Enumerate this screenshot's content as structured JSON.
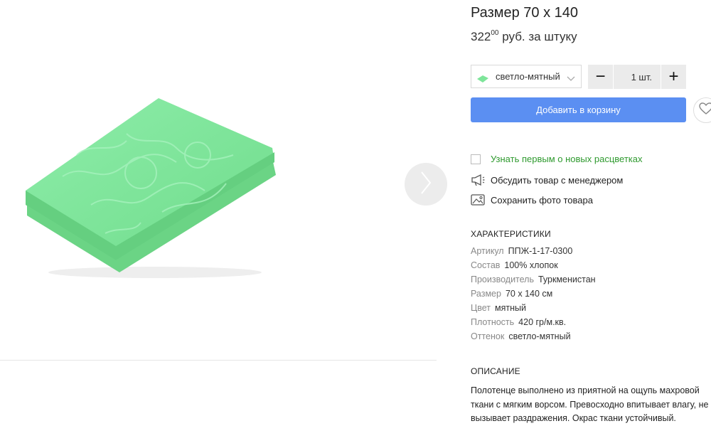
{
  "product": {
    "title": "Размер 70 х 140",
    "price_main": "322",
    "price_cents": "00",
    "price_unit": "руб. за штуку"
  },
  "color_select": {
    "selected": "светло-мятный",
    "swatch_color": "#7ee59a"
  },
  "quantity": {
    "minus": "−",
    "value": "1 шт.",
    "plus": "+"
  },
  "add_to_cart": "Добавить в корзину",
  "options": {
    "notify_label": "Узнать первым о новых расцветках",
    "discuss_label": "Обсудить товар с менеджером",
    "save_photo_label": "Сохранить фото товара"
  },
  "characteristics": {
    "heading": "ХАРАКТЕРИСТИКИ",
    "rows": [
      {
        "key": "Артикул",
        "value": "ППЖ-1-17-0300"
      },
      {
        "key": "Состав",
        "value": "100% хлопок"
      },
      {
        "key": "Производитель",
        "value": "Туркменистан"
      },
      {
        "key": "Размер",
        "value": "70 х 140 см"
      },
      {
        "key": "Цвет",
        "value": "мятный"
      },
      {
        "key": "Плотность",
        "value": "420 гр/м.кв."
      },
      {
        "key": "Оттенок",
        "value": "светло-мятный"
      }
    ]
  },
  "description": {
    "heading": "ОПИСАНИЕ",
    "text": "Полотенце выполнено из приятной на ощупь махровой ткани с мягким ворсом. Превосходно впитывает влагу, не вызывает раздражения. Окрас ткани устойчивый."
  },
  "colors": {
    "accent": "#5b8ff2",
    "link_green": "#2f9a2f",
    "towel_green": "#7ee59a"
  },
  "icons": {
    "next": "chevron-right-icon",
    "favorite": "heart-icon",
    "discuss": "megaphone-icon",
    "save_photo": "image-icon",
    "dropdown": "chevron-down-icon"
  }
}
